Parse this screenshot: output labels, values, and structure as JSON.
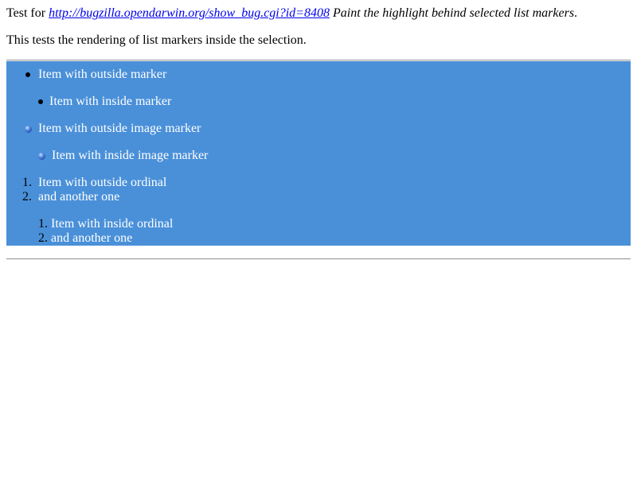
{
  "header": {
    "prefix": "Test for ",
    "link_text": "http://bugzilla.opendarwin.org/show_bug.cgi?id=8408",
    "title": " Paint the highlight behind selected list markers",
    "suffix": "."
  },
  "description": "This tests the rendering of list markers inside the selection.",
  "colors": {
    "selection_background": "#4a90d9",
    "selection_text": "#ffffff",
    "link": "#0000ee"
  },
  "lists": {
    "outside_marker": {
      "icon": "bullet-disc-icon",
      "items": [
        "Item with outside marker"
      ]
    },
    "inside_marker": {
      "icon": "bullet-disc-icon",
      "items": [
        "Item with inside marker"
      ]
    },
    "outside_image_marker": {
      "icon": "blue-ball-icon",
      "items": [
        "Item with outside image marker"
      ]
    },
    "inside_image_marker": {
      "icon": "blue-ball-icon",
      "items": [
        "Item with inside image marker"
      ]
    },
    "outside_ordinal": {
      "markers": [
        "1.",
        "2."
      ],
      "items": [
        "Item with outside ordinal",
        "and another one"
      ]
    },
    "inside_ordinal": {
      "markers": [
        "1.",
        "2."
      ],
      "items": [
        "Item with inside ordinal",
        "and another one"
      ]
    }
  }
}
